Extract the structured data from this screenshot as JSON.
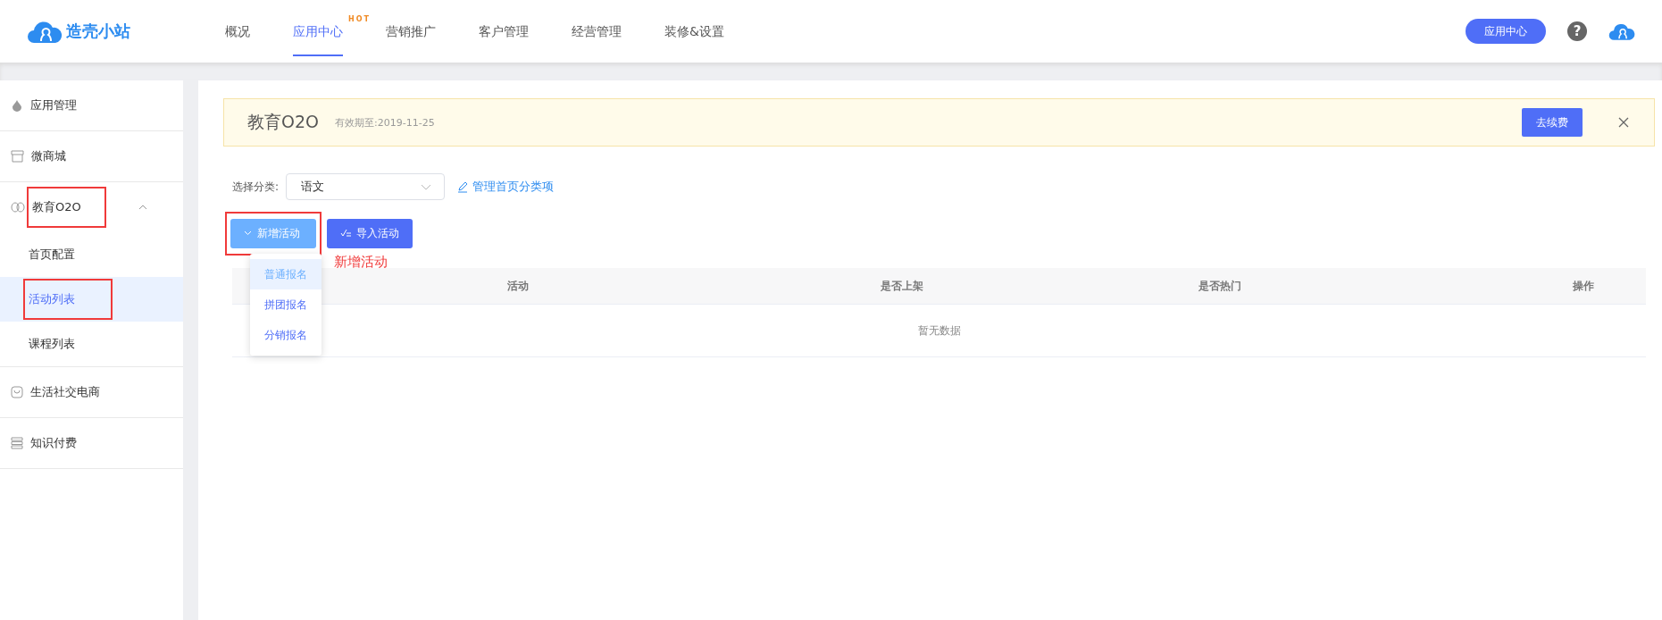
{
  "header": {
    "logo": "造壳小站",
    "nav": [
      {
        "label": "概况",
        "selected": false
      },
      {
        "label": "应用中心",
        "selected": true,
        "badge": "HOT"
      },
      {
        "label": "营销推广",
        "selected": false
      },
      {
        "label": "客户管理",
        "selected": false
      },
      {
        "label": "经营管理",
        "selected": false
      },
      {
        "label": "装修&设置",
        "selected": false
      }
    ],
    "app_center_button": "应用中心",
    "help_icon": "?"
  },
  "sidebar": {
    "items": [
      {
        "label": "应用管理",
        "kind": "drop",
        "highlighted": false
      },
      {
        "label": "微商城",
        "kind": "store",
        "highlighted": false
      },
      {
        "label": "教育O2O",
        "kind": "brain",
        "highlighted": true,
        "expanded": true,
        "children": [
          {
            "label": "首页配置",
            "selected": false,
            "highlighted": false
          },
          {
            "label": "活动列表",
            "selected": true,
            "highlighted": true
          },
          {
            "label": "课程列表",
            "selected": false,
            "highlighted": false
          }
        ]
      },
      {
        "label": "生活社交电商",
        "kind": "bag",
        "highlighted": false
      },
      {
        "label": "知识付费",
        "kind": "stack",
        "highlighted": false
      }
    ]
  },
  "banner": {
    "title": "教育O2O",
    "expiry": "有效期至:2019-11-25",
    "renew_button": "去续费"
  },
  "filter": {
    "label": "选择分类:",
    "value": "语文",
    "manage_link": "管理首页分类项"
  },
  "actions": {
    "add_button": "新增活动",
    "add_highlighted": true,
    "import_button": "导入活动",
    "annotation": "新增活动",
    "menu": [
      {
        "label": "普通报名",
        "selected": true
      },
      {
        "label": "拼团报名",
        "selected": false
      },
      {
        "label": "分销报名",
        "selected": false
      }
    ]
  },
  "table": {
    "columns": [
      "活动",
      "是否上架",
      "是否热门",
      "操作"
    ],
    "empty_text": "暂无数据"
  }
}
